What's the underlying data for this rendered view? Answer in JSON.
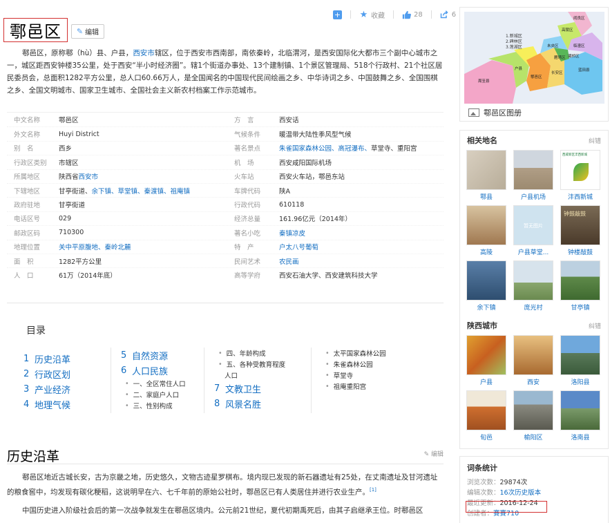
{
  "toolbar": {
    "collect_label": "收藏",
    "like_count": "28",
    "share_count": "6"
  },
  "header": {
    "title": "鄠邑区",
    "edit_label": "编辑"
  },
  "summary": {
    "t1": "鄠邑区，原称鄠（hù）县、户县，",
    "l1": "西安市",
    "t2": "辖区，位于西安市西南部，南依秦岭，北临渭河，是西安国际化大都市三个副中心城市之一，城区距西安钟楼35公里，处于西安“半小时经济圈”。辖1个街道办事处、13个建制镇、1个景区管理局、518个行政村、21个社区居民委员会，总面积1282平方公里，总人口60.66万人，是全国闻名的中国现代民间绘画之乡、中华诗词之乡、中国鼓舞之乡、全国围棋之乡、全国文明城市、国家卫生城市、全国社会主义新农村档案工作示范城市。"
  },
  "info": {
    "left": [
      {
        "key": "中文名称",
        "val": "鄠邑区"
      },
      {
        "key": "外文名称",
        "val": "Huyi District"
      },
      {
        "key": "别　名",
        "val": "西乡"
      },
      {
        "key": "行政区类别",
        "val": "市辖区"
      },
      {
        "key": "所属地区",
        "val_pre": "陕西省",
        "val_link": "西安市"
      },
      {
        "key": "下辖地区",
        "val_pre": "甘亭街道、",
        "val_link": "余下镇、草堂镇、秦渡镇、祖庵镇"
      },
      {
        "key": "政府驻地",
        "val": "甘亭街道"
      },
      {
        "key": "电话区号",
        "val": "029"
      },
      {
        "key": "邮政区码",
        "val": "710300"
      },
      {
        "key": "地理位置",
        "val_link": "关中平原腹地、秦岭北麓"
      },
      {
        "key": "面　积",
        "val": "1282平方公里"
      },
      {
        "key": "人　口",
        "val": "61万（2014年底）"
      }
    ],
    "right": [
      {
        "key": "方　言",
        "val": "西安话"
      },
      {
        "key": "气候条件",
        "val": "暖温带大陆性季风型气候"
      },
      {
        "key": "著名景点",
        "val_link": "朱雀国家森林公园、高冠瀑布、",
        "val_post": "草堂寺、重阳宫"
      },
      {
        "key": "机　场",
        "val": "西安咸阳国际机场"
      },
      {
        "key": "火车站",
        "val": "西安火车站，鄠邑东站"
      },
      {
        "key": "车牌代码",
        "val": "陕A"
      },
      {
        "key": "行政代码",
        "val": "610118"
      },
      {
        "key": "经济总量",
        "val": "161.96亿元（2014年）"
      },
      {
        "key": "著名小吃",
        "val_link": "秦镇凉皮"
      },
      {
        "key": "特　产",
        "val_link": "户太八号葡萄"
      },
      {
        "key": "民间艺术",
        "val_link": "农民画"
      },
      {
        "key": "高等学府",
        "val": "西安石油大学、西安建筑科技大学"
      }
    ]
  },
  "toc": {
    "title": "目录",
    "col1": [
      {
        "num": "1",
        "label": "历史沿革"
      },
      {
        "num": "2",
        "label": "行政区划"
      },
      {
        "num": "3",
        "label": "产业经济"
      },
      {
        "num": "4",
        "label": "地理气候"
      }
    ],
    "col2_items": [
      {
        "num": "5",
        "label": "自然资源"
      },
      {
        "num": "6",
        "label": "人口民族"
      }
    ],
    "col2_subs": [
      "一、全区常住人口",
      "二、家庭户人口",
      "三、性别构成"
    ],
    "col3_subs": [
      "四、年龄构成",
      "五、各种受教育程度",
      "人口"
    ],
    "col3_items": [
      {
        "num": "7",
        "label": "文教卫生"
      },
      {
        "num": "8",
        "label": "风景名胜"
      }
    ],
    "col4_subs": [
      "太平国家森林公园",
      "朱雀森林公园",
      "草堂寺",
      "祖庵重阳宫"
    ]
  },
  "section": {
    "title": "历史沿革",
    "edit_label": "编辑",
    "p1": "鄠邑区地近古城长安，古为京畿之地，历史悠久，文物古迹星罗棋布。境内现已发现的新石器遗址有25处，在丈南遗址及甘河遗址的粮食窖中，均发现有碳化粳稻，这说明早在六、七千年前的原始公社时，鄠邑区已有人类居住并进行农业生产。",
    "p1_ref": "[1]",
    "p2": "中国历史进入阶级社会后的第一次战争就发生在鄠邑区境内。公元前21世纪，夏代初期禹死后，由其子启继承王位。时鄠邑区"
  },
  "sidebar": {
    "map_caption": "鄠邑区图册",
    "map_legend": [
      "1.新城区",
      "2.碑林区",
      "3.莲湖区"
    ],
    "map_regions": [
      "周至县",
      "户县",
      "鄠邑区",
      "长安区",
      "雁塔区",
      "临潼区",
      "蓝田县",
      "高陵区",
      "阎良区",
      "未央区",
      "灞桥区"
    ],
    "related_title": "相关地名",
    "related_err": "纠错",
    "related": [
      "鄠县",
      "户县机场",
      "沣西新城",
      "高陵",
      "户县草堂...",
      "钟楼敲鼓",
      "余下镇",
      "庞光村",
      "甘亭镇"
    ],
    "cities_title": "陕西城市",
    "cities_err": "纠错",
    "cities": [
      "户县",
      "西安",
      "洛阳县",
      "旬邑",
      "榆阳区",
      "洛南县"
    ],
    "thumb_badge": "暂无图片",
    "thumb_sign": "钟鼓敲鼓",
    "thumb_brand": "西咸新区沣西新城",
    "stats": {
      "title": "词条统计",
      "views_label": "浏览次数：",
      "views": "29874次",
      "edits_label": "编辑次数：",
      "edits": "16次历史版本",
      "updated_label": "最近更新：",
      "updated": "2016-12-24",
      "creator_label": "创建者：",
      "creator": "賽賽710"
    }
  },
  "colors": {
    "link": "#136ec2",
    "accent": "#4f9cee",
    "highlight_border": "#d32f2f"
  }
}
